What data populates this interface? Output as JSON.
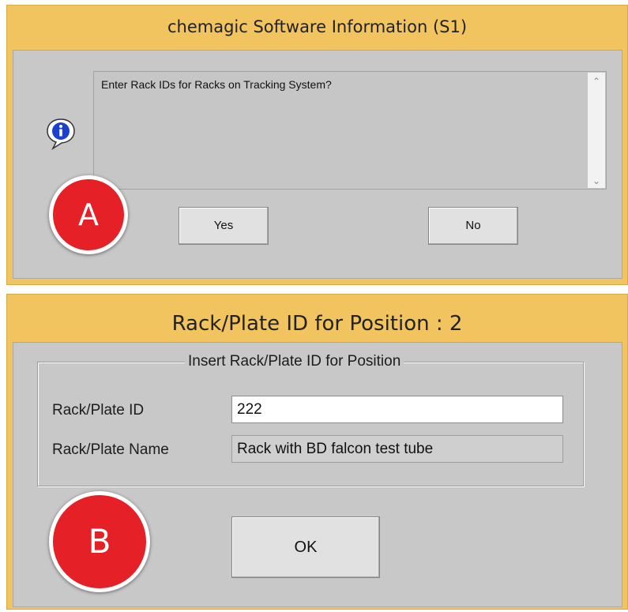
{
  "dialog_a": {
    "title": "chemagic Software Information (S1)",
    "icon": "info-icon",
    "message": "Enter Rack IDs for Racks on Tracking System?",
    "yes_label": "Yes",
    "no_label": "No"
  },
  "dialog_b": {
    "title": "Rack/Plate ID for Position : 2",
    "group_label": "Insert Rack/Plate ID for Position",
    "id_label": "Rack/Plate ID",
    "id_value": "222",
    "name_label": "Rack/Plate Name",
    "name_value": "Rack with BD falcon test tube",
    "ok_label": "OK"
  },
  "markers": {
    "a": "A",
    "b": "B"
  },
  "colors": {
    "window_frame": "#f2c45f",
    "client_background": "#c8c8c8",
    "marker": "#e52026"
  }
}
